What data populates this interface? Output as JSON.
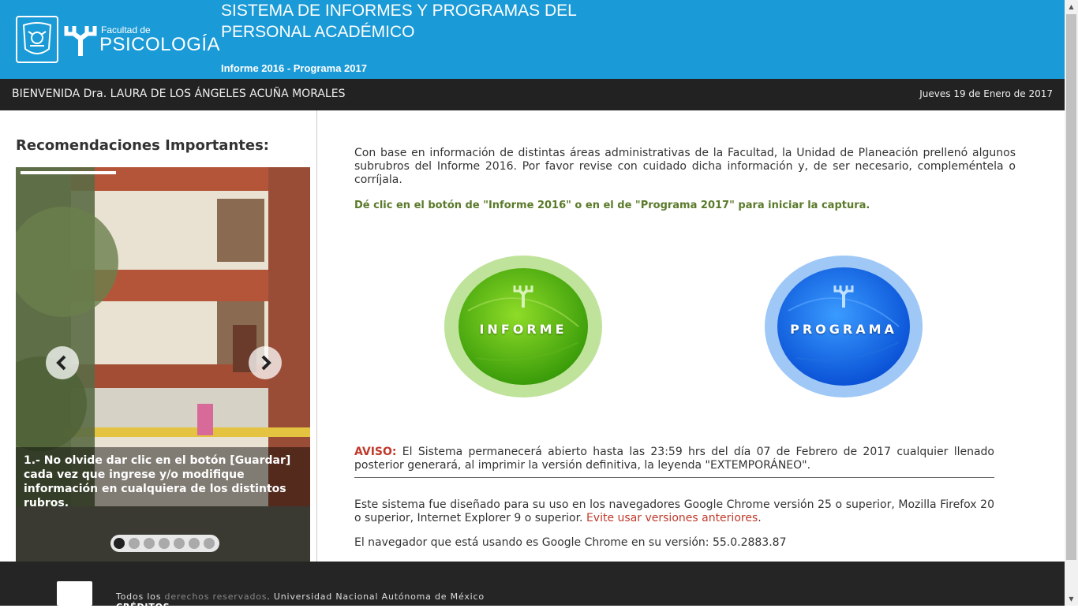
{
  "header": {
    "faculty_small": "Facultad de",
    "faculty_big": "PSICOLOGÍA",
    "title_line1": "SISTEMA DE INFORMES Y PROGRAMAS DEL",
    "title_line2": "PERSONAL ACADÉMICO",
    "subtitle": "Informe 2016 - Programa 2017",
    "color": "#1a9ad6"
  },
  "userbar": {
    "welcome": "BIENVENIDA Dra. LAURA DE LOS ÁNGELES ACUÑA MORALES",
    "date": "Jueves 19 de Enero de 2017"
  },
  "sidebar": {
    "title": "Recomendaciones Importantes:",
    "carousel": {
      "caption": "1.- No olvide dar clic en el botón [Guardar] cada vez que ingrese y/o modifique información en cualquiera de los distintos rubros.",
      "prev_icon": "chevron-left-icon",
      "next_icon": "chevron-right-icon",
      "dots": 7,
      "active_dot": 1
    }
  },
  "main": {
    "intro": "Con base en información de distintas áreas administrativas de la Facultad, la Unidad de Planeación prellenó algunos subrubros del Informe 2016. Por favor revise con cuidado dicha información y, de ser necesario, compleméntela o corríjala.",
    "instruction": "Dé clic en el botón de \"Informe 2016\" o en el de \"Programa 2017\" para iniciar la captura.",
    "informe_label": "INFORME",
    "programa_label": "PROGRAMA",
    "aviso_label": "AVISO:",
    "aviso_text": " El Sistema permanecerá abierto hasta las 23:59 hrs del día 07 de Febrero de 2017 cualquier llenado posterior generará, al imprimir la versión definitiva, la leyenda \"EXTEMPORÁNEO\".",
    "browsers_text": "Este sistema fue diseñado para su uso en los navegadores Google Chrome versión 25 o superior, Mozilla Firefox 20 o superior, Internet Explorer 9 o superior. ",
    "browsers_warning": "Evite usar versiones anteriores",
    "browsers_end": ".",
    "browser_version": "El navegador que está usando es Google Chrome en su versión: 55.0.2883.87"
  },
  "footer": {
    "rights_prefix": "Todos los ",
    "rights_link": "derechos reservados",
    "rights_suffix": ". Universidad Nacional Autónoma de México",
    "credits": "CRÉDITOS"
  }
}
